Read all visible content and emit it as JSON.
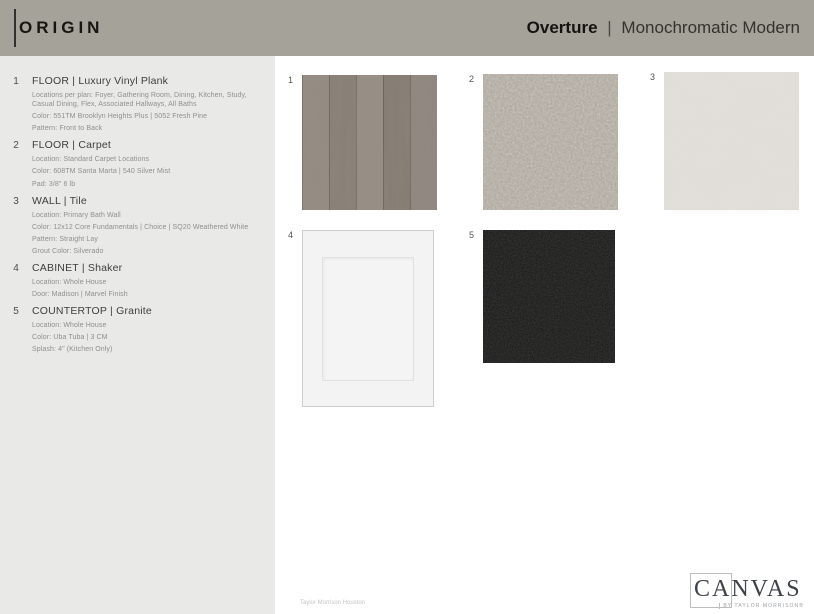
{
  "header": {
    "brand": "ORIGIN",
    "title_bold": "Overture",
    "title_sep": "|",
    "title_rest": "Monochromatic Modern"
  },
  "sidebar": {
    "items": [
      {
        "number": "1",
        "heading": "FLOOR | Luxury Vinyl Plank",
        "details": [
          "Locations per plan: Foyer, Gathering Room, Dining, Kitchen, Study, Casual Dining, Flex, Associated Hallways,  All Baths",
          "Color: 551TM Brooklyn Heights Plus | 5052 Fresh Pine",
          "Pattern: Front to Back"
        ]
      },
      {
        "number": "2",
        "heading": "FLOOR | Carpet",
        "details": [
          "Location: Standard Carpet Locations",
          "Color: 608TM Santa Marta | 540 Silver Mist",
          "Pad: 3/8\" 6 lb"
        ]
      },
      {
        "number": "3",
        "heading": "WALL | Tile",
        "details": [
          "Location: Primary Bath Wall",
          "Color: 12x12 Core Fundamentals | Choice | SQ20 Weathered White",
          "Pattern: Straight Lay",
          "Grout Color: Silverado"
        ]
      },
      {
        "number": "4",
        "heading": "CABINET | Shaker",
        "details": [
          "Location: Whole House",
          "Door: Madison | Marvel Finish"
        ]
      },
      {
        "number": "5",
        "heading": "COUNTERTOP | Granite",
        "details": [
          "Location: Whole House",
          "Color: Uba Tuba | 3 CM",
          "Splash: 4\" (Kitchen Only)"
        ]
      }
    ]
  },
  "swatches": [
    {
      "number": "1",
      "name": "luxury-vinyl-plank-swatch"
    },
    {
      "number": "2",
      "name": "carpet-swatch"
    },
    {
      "number": "3",
      "name": "wall-tile-swatch"
    },
    {
      "number": "4",
      "name": "cabinet-door-swatch"
    },
    {
      "number": "5",
      "name": "granite-countertop-swatch"
    }
  ],
  "footer": {
    "note": "Taylor Morrison Houston",
    "logo_text": "CANVAS",
    "logo_tagline": "BY TAYLOR MORRISON®"
  },
  "colors": {
    "header_bg": "#a5a29a",
    "sidebar_bg": "#e9e9e8",
    "wood_base": "#90877e",
    "carpet_base": "#aaa49b",
    "tile_base": "#e0ddd8",
    "door_base": "#f3f3f4",
    "granite_base": "#131313"
  }
}
